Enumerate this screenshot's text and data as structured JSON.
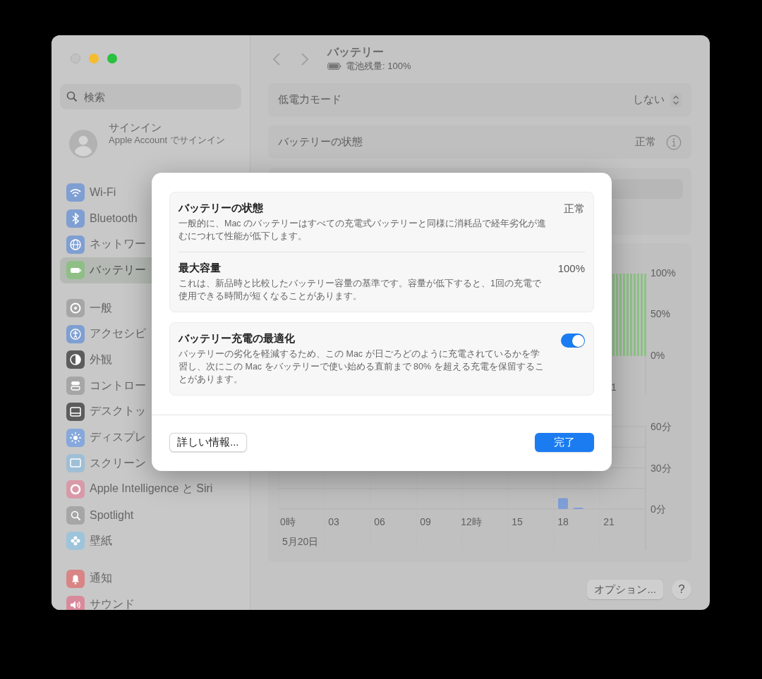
{
  "sidebar": {
    "search": {
      "placeholder": "検索"
    },
    "account": {
      "title": "サインイン",
      "subtitle": "Apple Account でサインイン"
    },
    "groups": [
      {
        "items": [
          {
            "label": "Wi-Fi",
            "selected": false,
            "color": "#7f9fd2"
          },
          {
            "label": "Bluetooth",
            "selected": false,
            "color": "#7f9fd2"
          },
          {
            "label": "ネットワー",
            "selected": false,
            "color": "#7f9fd2"
          },
          {
            "label": "バッテリー",
            "selected": true,
            "color": "#8fbf86"
          }
        ]
      },
      {
        "items": [
          {
            "label": "一般",
            "selected": false,
            "color": "#a6a6a6"
          },
          {
            "label": "アクセシビ",
            "selected": false,
            "color": "#7f9fd2"
          },
          {
            "label": "外観",
            "selected": false,
            "color": "#5c5c5c"
          },
          {
            "label": "コントロー",
            "selected": false,
            "color": "#a6a6a6"
          },
          {
            "label": "デスクトッ",
            "selected": false,
            "color": "#5c5c5c"
          },
          {
            "label": "ディスプレ",
            "selected": false,
            "color": "#86a8dc"
          },
          {
            "label": "スクリーン",
            "selected": false,
            "color": "#9ebfd6"
          },
          {
            "label": "Apple Intelligence と Siri",
            "selected": false,
            "color": "#d89aa8"
          },
          {
            "label": "Spotlight",
            "selected": false,
            "color": "#a6a6a6"
          },
          {
            "label": "壁紙",
            "selected": false,
            "color": "#9ec4dc"
          }
        ]
      },
      {
        "items": [
          {
            "label": "通知",
            "selected": false,
            "color": "#d98585"
          },
          {
            "label": "サウンド",
            "selected": false,
            "color": "#d98a9a"
          }
        ]
      }
    ]
  },
  "header": {
    "title": "バッテリー",
    "subtitle": "電池残量: 100%"
  },
  "settings": [
    {
      "label": "低電力モード",
      "value": "しない",
      "kind": "popup"
    },
    {
      "label": "バッテリーの状態",
      "value": "正常",
      "kind": "info"
    }
  ],
  "level_chart": {
    "y_labels": [
      "100%",
      "50%",
      "0%"
    ],
    "x_tick_fragment": "1"
  },
  "usage_chart": {
    "chart_data": {
      "type": "bar",
      "x": [
        18,
        19
      ],
      "values": [
        8,
        1
      ],
      "xlim": [
        -0.6,
        23.4
      ],
      "ylim": [
        0,
        60
      ],
      "yticks": [
        {
          "value": 60,
          "label": "60分"
        },
        {
          "value": 30,
          "label": "30分"
        },
        {
          "value": 0,
          "label": "0分"
        }
      ],
      "xticks": [
        {
          "value": 0,
          "label": "0時"
        },
        {
          "value": 3,
          "label": "03"
        },
        {
          "value": 6,
          "label": "06"
        },
        {
          "value": 9,
          "label": "09"
        },
        {
          "value": 12,
          "label": "12時"
        },
        {
          "value": 15,
          "label": "15"
        },
        {
          "value": 18,
          "label": "18"
        },
        {
          "value": 21,
          "label": "21"
        }
      ],
      "xlabel": "5月20日"
    }
  },
  "footer": {
    "options": "オプション...",
    "help": "?"
  },
  "dialog": {
    "sections": [
      {
        "title": "バッテリーの状態",
        "value": "正常",
        "description": "一般的に、Mac のバッテリーはすべての充電式バッテリーと同様に消耗品で経年劣化が進むにつれて性能が低下します。"
      },
      {
        "title": "最大容量",
        "value": "100%",
        "description": "これは、新品時と比較したバッテリー容量の基準です。容量が低下すると、1回の充電で使用できる時間が短くなることがあります。"
      }
    ],
    "optimization": {
      "title": "バッテリー充電の最適化",
      "description": "バッテリーの劣化を軽減するため、この Mac が日ごろどのように充電されているかを学習し、次にこの Mac をバッテリーで使い始める直前まで 80% を超える充電を保留することがあります。",
      "on": true
    },
    "buttons": [
      {
        "label": "詳しい情報...",
        "kind": "secondary"
      },
      {
        "label": "完了",
        "kind": "primary"
      }
    ]
  }
}
